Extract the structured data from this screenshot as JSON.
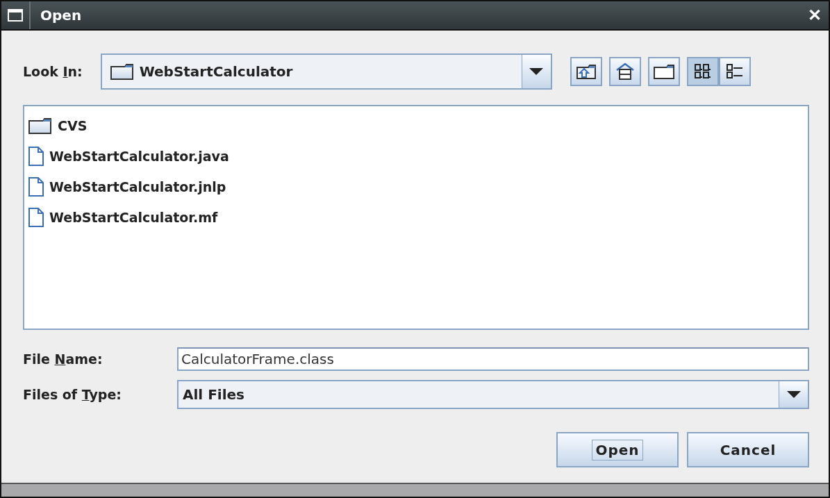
{
  "window": {
    "title": "Open",
    "close": "✕"
  },
  "look_in": {
    "label": {
      "before": "Look ",
      "key": "I",
      "after": "n:"
    },
    "value": "WebStartCalculator"
  },
  "toolbar": [
    {
      "kind": "up",
      "selected": false
    },
    {
      "kind": "home",
      "selected": false
    },
    {
      "kind": "new_folder",
      "selected": false
    },
    {
      "kind": "list",
      "selected": true
    },
    {
      "kind": "details",
      "selected": false
    }
  ],
  "files": [
    {
      "name": "CVS",
      "kind": "folder"
    },
    {
      "name": "WebStartCalculator.java",
      "kind": "file"
    },
    {
      "name": "WebStartCalculator.jnlp",
      "kind": "file"
    },
    {
      "name": "WebStartCalculator.mf",
      "kind": "file"
    }
  ],
  "file_name": {
    "label": {
      "before": "File ",
      "key": "N",
      "after": "ame:"
    },
    "value": "CalculatorFrame.class"
  },
  "file_type": {
    "label": {
      "before": "Files of ",
      "key": "T",
      "after": "ype:"
    },
    "value": "All Files"
  },
  "buttons": [
    {
      "label": "Open",
      "focused": true
    },
    {
      "label": "Cancel",
      "focused": false
    }
  ]
}
